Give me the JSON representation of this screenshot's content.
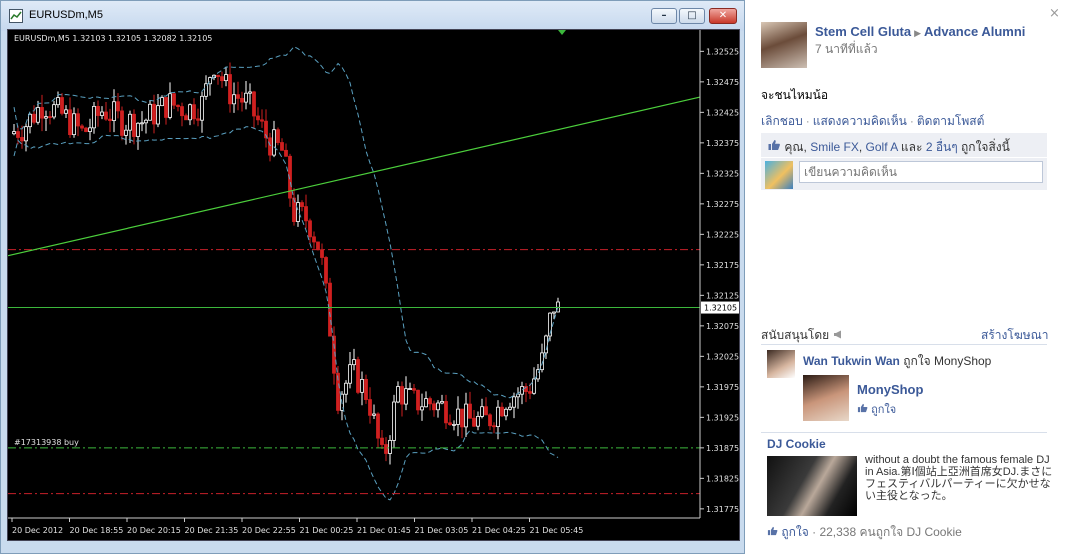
{
  "window": {
    "title": "EURUSDm,M5",
    "min_glyph": "–",
    "max_glyph": "□",
    "close_glyph": "✕"
  },
  "chart_data": {
    "type": "candlestick",
    "symbol_header": "EURUSDm,M5  1.32103 1.32105 1.32082 1.32105",
    "current_price_label": "1.32105",
    "order_label": "#17313938 buy",
    "y_ticks": [
      "1.32525",
      "1.32475",
      "1.32425",
      "1.32375",
      "1.32325",
      "1.32275",
      "1.32225",
      "1.32175",
      "1.32125",
      "1.32075",
      "1.32025",
      "1.31975",
      "1.31925",
      "1.31875",
      "1.31825",
      "1.31775"
    ],
    "x_ticks": [
      "20 Dec 2012",
      "20 Dec 18:55",
      "20 Dec 20:15",
      "20 Dec 21:35",
      "20 Dec 22:55",
      "21 Dec 00:25",
      "21 Dec 01:45",
      "21 Dec 03:05",
      "21 Dec 04:25",
      "21 Dec 05:45"
    ],
    "ylim": [
      1.3176,
      1.3256
    ],
    "hlines": [
      {
        "name": "red-level-upper",
        "value": 1.322,
        "color": "#c8202a",
        "style": "dashdot"
      },
      {
        "name": "price-line",
        "value": 1.32105,
        "color": "#3cb83c",
        "style": "solid"
      },
      {
        "name": "order-line",
        "value": 1.31875,
        "color": "#3cb83c",
        "style": "dashdot"
      },
      {
        "name": "red-level-lower",
        "value": 1.318,
        "color": "#c8202a",
        "style": "dashdot"
      }
    ],
    "trendline": {
      "from": [
        0,
        1.3219
      ],
      "to": [
        1,
        1.3245
      ],
      "color": "#4ccf3c"
    },
    "bull_color": "#ffffff",
    "bear_color": "#d02020",
    "band_color": "#5aa0c0",
    "bg_color": "#000000"
  },
  "fb": {
    "close_glyph": "×",
    "post": {
      "author": "Stem Cell Gluta",
      "target": "Advance Alumni",
      "arrow": "▶",
      "time": "7 นาทีที่แล้ว",
      "text": "จะชนไหมน้อ",
      "actions": [
        "เลิกชอบ",
        "แสดงความคิดเห็น",
        "ติดตามโพสต์"
      ],
      "likes_prefix": "คุณ,",
      "likes_names": [
        "Smile FX",
        "Golf A"
      ],
      "likes_and": "และ",
      "likes_others": "2 อื่นๆ",
      "likes_suffix": "ถูกใจสิ่งนี้",
      "comment_placeholder": "เขียนความคิดเห็น"
    },
    "sponsored": {
      "title": "สนับสนุนโดย",
      "create_ad": "สร้างโฆษณา",
      "ad1": {
        "user": "Wan Tukwin Wan",
        "likes_text": "ถูกใจ MonyShop",
        "page": "MonyShop",
        "like_btn": "ถูกใจ"
      },
      "ad2": {
        "title": "DJ Cookie",
        "text": "without a doubt the famous female DJ in Asia.第Ⅰ個站上亞洲首席女DJ.まさにフェスティバルパーティーに欠かせない主役となった。",
        "like_btn": "ถูกใจ",
        "count_text": "· 22,338 คนถูกใจ DJ Cookie"
      }
    }
  }
}
